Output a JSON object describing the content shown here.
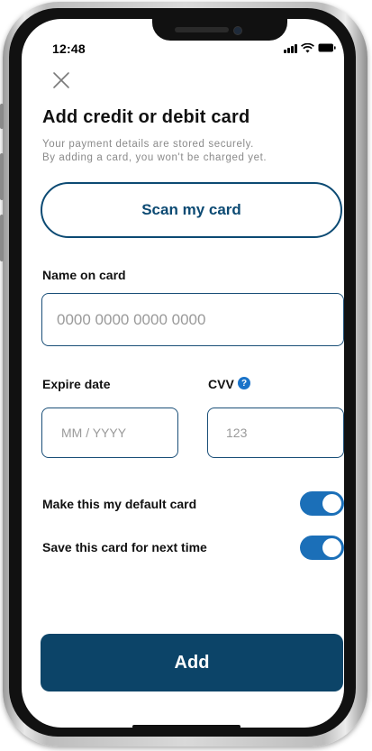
{
  "status_bar": {
    "time": "12:48",
    "signal_icon": "signal-icon",
    "wifi_icon": "wifi-icon",
    "battery_icon": "battery-icon"
  },
  "header": {
    "close_icon": "close-icon",
    "title": "Add credit or debit card",
    "subtitle_line1": "Your payment details are stored securely.",
    "subtitle_line2": "By adding a card, you won't be charged yet."
  },
  "scan_button": {
    "label": "Scan my card"
  },
  "form": {
    "name_label": "Name on card",
    "name_placeholder": "0000 0000 0000 0000",
    "expire_label": "Expire date",
    "expire_placeholder": "MM / YYYY",
    "cvv_label": "CVV",
    "cvv_help_icon": "question-icon",
    "cvv_placeholder": "123"
  },
  "toggles": [
    {
      "label": "Make this my default card",
      "on": true
    },
    {
      "label": "Save this card for next time",
      "on": true
    }
  ],
  "add_button": {
    "label": "Add"
  },
  "colors": {
    "primary": "#0c4468",
    "scan_border": "#0c4a73",
    "toggle_on": "#1b6fb8",
    "help_icon": "#1a73c9"
  }
}
